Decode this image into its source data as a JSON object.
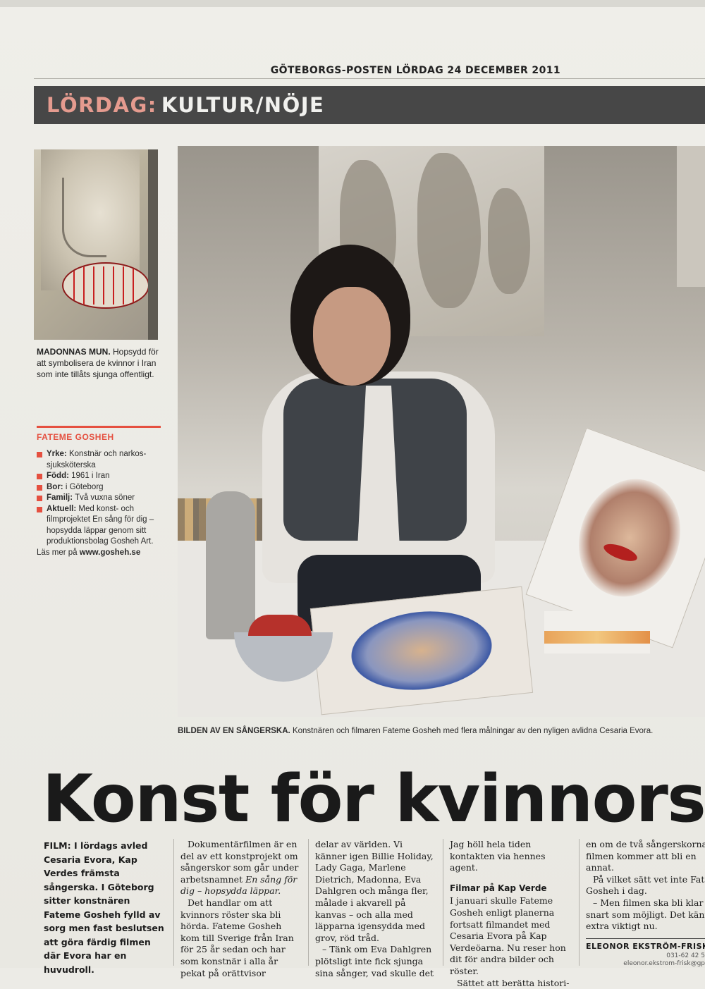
{
  "masthead": "GÖTEBORGS-POSTEN LÖRDAG 24 DECEMBER 2011",
  "section": {
    "part1": "LÖRDAG:",
    "part2": "KULTUR/NÖJE"
  },
  "small_photo_caption": {
    "lead": "MADONNAS MUN.",
    "text": "Hopsydd för att symbolisera de kvinnor i Iran som inte tillåts sjunga offentligt."
  },
  "factbox": {
    "title": "FATEME GOSHEH",
    "items": [
      {
        "key": "Yrke:",
        "value": "Konstnär och narkos-sjuksköterska"
      },
      {
        "key": "Född:",
        "value": "1961 i Iran"
      },
      {
        "key": "Bor:",
        "value": "i Göteborg"
      },
      {
        "key": "Familj:",
        "value": "Två vuxna söner"
      },
      {
        "key": "Aktuell:",
        "value": "Med konst- och filmprojektet En sång för dig – hopsydda läppar genom sitt produktionsbolag Gosheh Art."
      }
    ],
    "more_text": "Läs mer på",
    "website": "www.gosheh.se"
  },
  "main_photo_caption": {
    "lead": "BILDEN AV EN SÅNGERSKA.",
    "text": "Konstnären och filmaren Fateme Gosheh med flera målningar av den nyligen avlidna Cesaria Evora."
  },
  "headline": "Konst för kvinnors s",
  "article": {
    "ingress_label": "FILM:",
    "ingress": "I lördags avled Cesaria Evora, Kap Verdes främsta sångerska. I Göteborg sitter konstnären Fateme Gosheh fylld av sorg men fast beslutsen att göra färdig filmen där Evora har en huvudroll.",
    "col2_p1": "Dokumentärfilmen är en del av ett konstprojekt om sångerskor som går under arbetsnamnet",
    "col2_title": "En sång för dig – hopsydda läppar.",
    "col2_p2": "Det handlar om att kvinnors röster ska bli hörda. Fateme Gosheh kom till Sverige från Iran för 25 år sedan och har som konstnär i alla år pekat på orättvisor",
    "col3_p1": "delar av världen. Vi känner igen Billie Holiday, Lady Gaga, Marlene Dietrich, Madonna, Eva Dahlgren och många fler, målade i akvarell på kanvas – och alla med läpparna igensydda med grov, röd tråd.",
    "col3_p2": "– Tänk om Eva Dahlgren plötsligt inte fick sjunga sina sånger, vad skulle det",
    "col4_p1": "Jag höll hela tiden kontakten via hennes agent.",
    "col4_subhead": "Filmar på Kap Verde",
    "col4_p2": "I januari skulle Fateme Gosheh enligt planerna fortsatt filmandet med Cesaria Evora på Kap Verdeöarna. Nu reser hon dit för andra bilder och röster.",
    "col4_p3": "Sättet att berätta histori-",
    "col5_p1": "en om de två sångerskorna i filmen kommer att bli en annat.",
    "col5_p2": "På vilket sätt vet inte Fateme Gosheh i dag.",
    "col5_p3": "– Men filmen ska bli klar så snart som möjligt. Det känns extra viktigt nu.",
    "byline": "ELEONOR EKSTRÖM-FRISK",
    "phone": "031-62 42 5",
    "email": "eleonor.ekstrom-frisk@gp"
  },
  "colors": {
    "accent": "#e55040",
    "section_bar": "#474747",
    "section_accent": "#e59b8f"
  }
}
